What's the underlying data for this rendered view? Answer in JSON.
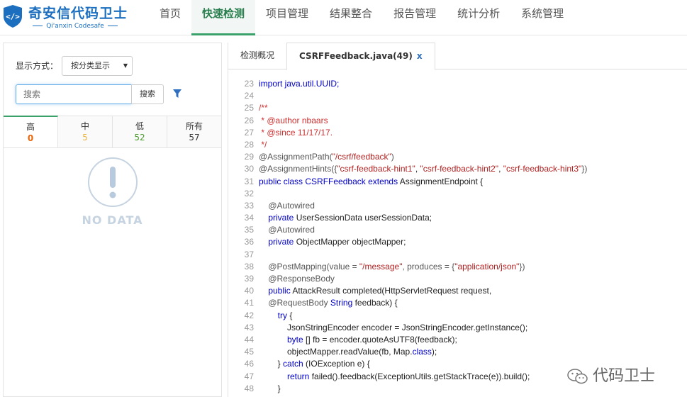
{
  "header": {
    "logo_title": "奇安信代码卫士",
    "logo_sub": "Qi'anxin Codesafe",
    "nav": [
      {
        "label": "首页",
        "active": false
      },
      {
        "label": "快速检测",
        "active": true
      },
      {
        "label": "项目管理",
        "active": false
      },
      {
        "label": "结果整合",
        "active": false
      },
      {
        "label": "报告管理",
        "active": false
      },
      {
        "label": "统计分析",
        "active": false
      },
      {
        "label": "系统管理",
        "active": false
      }
    ]
  },
  "left": {
    "display_label": "显示方式：",
    "display_value": "按分类显示",
    "search_placeholder": "搜索",
    "search_button": "搜索",
    "tabs": [
      {
        "label": "高",
        "count": "0",
        "color": "#e8650a"
      },
      {
        "label": "中",
        "count": "5",
        "color": "#e8b440"
      },
      {
        "label": "低",
        "count": "52",
        "color": "#4a9a2e"
      },
      {
        "label": "所有",
        "count": "57",
        "color": "#333333"
      }
    ],
    "no_data": "NO DATA"
  },
  "right": {
    "tabs": [
      {
        "label": "检测概况",
        "active": false
      },
      {
        "label": "CSRFFeedback.java(49)",
        "active": true,
        "close": "x"
      }
    ],
    "code_lines": [
      {
        "n": "23",
        "segs": [
          {
            "t": "import java.util.UUID;",
            "c": "kw0"
          }
        ]
      },
      {
        "n": "24",
        "segs": []
      },
      {
        "n": "25",
        "segs": [
          {
            "t": "/**",
            "c": "cm"
          }
        ]
      },
      {
        "n": "26",
        "segs": [
          {
            "t": " * @author nbaars",
            "c": "cm"
          }
        ]
      },
      {
        "n": "27",
        "segs": [
          {
            "t": " * @since 11/17/17.",
            "c": "cm"
          }
        ]
      },
      {
        "n": "28",
        "segs": [
          {
            "t": " */",
            "c": "cm"
          }
        ]
      },
      {
        "n": "29",
        "segs": [
          {
            "t": "@AssignmentPath(",
            "c": "an"
          },
          {
            "t": "\"/csrf/feedback\"",
            "c": "str"
          },
          {
            "t": ")",
            "c": "an"
          }
        ]
      },
      {
        "n": "30",
        "segs": [
          {
            "t": "@AssignmentHints({",
            "c": "an"
          },
          {
            "t": "\"csrf-feedback-hint1\"",
            "c": "str"
          },
          {
            "t": ", ",
            "c": ""
          },
          {
            "t": "\"csrf-feedback-hint2\"",
            "c": "str"
          },
          {
            "t": ", ",
            "c": ""
          },
          {
            "t": "\"csrf-feedback-hint3\"",
            "c": "str"
          },
          {
            "t": "})",
            "c": "an"
          }
        ]
      },
      {
        "n": "31",
        "segs": [
          {
            "t": "public class ",
            "c": "kw"
          },
          {
            "t": "CSRFFeedback ",
            "c": "kw"
          },
          {
            "t": "extends ",
            "c": "kw"
          },
          {
            "t": "AssignmentEndpoint {",
            "c": ""
          }
        ]
      },
      {
        "n": "32",
        "segs": []
      },
      {
        "n": "33",
        "segs": [
          {
            "t": "    @Autowired",
            "c": "an"
          }
        ]
      },
      {
        "n": "34",
        "segs": [
          {
            "t": "    private ",
            "c": "kw"
          },
          {
            "t": "UserSessionData userSessionData;",
            "c": ""
          }
        ]
      },
      {
        "n": "35",
        "segs": [
          {
            "t": "    @Autowired",
            "c": "an"
          }
        ]
      },
      {
        "n": "36",
        "segs": [
          {
            "t": "    private ",
            "c": "kw"
          },
          {
            "t": "ObjectMapper objectMapper;",
            "c": ""
          }
        ]
      },
      {
        "n": "37",
        "segs": []
      },
      {
        "n": "38",
        "segs": [
          {
            "t": "    @PostMapping(value = ",
            "c": "an"
          },
          {
            "t": "\"/message\"",
            "c": "str"
          },
          {
            "t": ", produces = {",
            "c": "an"
          },
          {
            "t": "\"application/json\"",
            "c": "str"
          },
          {
            "t": "})",
            "c": "an"
          }
        ]
      },
      {
        "n": "39",
        "segs": [
          {
            "t": "    @ResponseBody",
            "c": "an"
          }
        ]
      },
      {
        "n": "40",
        "segs": [
          {
            "t": "    public ",
            "c": "kw"
          },
          {
            "t": "AttackResult completed(HttpServletRequest request,",
            "c": ""
          }
        ]
      },
      {
        "n": "41",
        "segs": [
          {
            "t": "    @RequestBody ",
            "c": "an"
          },
          {
            "t": "String ",
            "c": "kw"
          },
          {
            "t": "feedback) {",
            "c": ""
          }
        ]
      },
      {
        "n": "42",
        "segs": [
          {
            "t": "        try ",
            "c": "kw"
          },
          {
            "t": "{",
            "c": ""
          }
        ]
      },
      {
        "n": "43",
        "segs": [
          {
            "t": "            JsonStringEncoder encoder = JsonStringEncoder.getInstance();",
            "c": ""
          }
        ]
      },
      {
        "n": "44",
        "segs": [
          {
            "t": "            byte ",
            "c": "kw"
          },
          {
            "t": "[] fb = encoder.quoteAsUTF8(feedback);",
            "c": ""
          }
        ]
      },
      {
        "n": "45",
        "segs": [
          {
            "t": "            objectMapper.readValue(fb, Map.",
            "c": ""
          },
          {
            "t": "class",
            "c": "kw"
          },
          {
            "t": ");",
            "c": ""
          }
        ]
      },
      {
        "n": "46",
        "segs": [
          {
            "t": "        } ",
            "c": ""
          },
          {
            "t": "catch ",
            "c": "kw"
          },
          {
            "t": "(IOException e) {",
            "c": ""
          }
        ]
      },
      {
        "n": "47",
        "segs": [
          {
            "t": "            return ",
            "c": "kw"
          },
          {
            "t": "failed().feedback(ExceptionUtils.getStackTrace(e)).build();",
            "c": ""
          }
        ]
      },
      {
        "n": "48",
        "segs": [
          {
            "t": "        }",
            "c": ""
          }
        ]
      }
    ]
  },
  "watermark": "代码卫士",
  "colors": {
    "accent_green": "#3aa16a",
    "brand_blue": "#1c6fbf"
  }
}
